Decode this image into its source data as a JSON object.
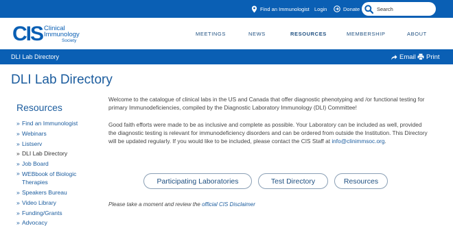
{
  "utility": {
    "find_immunologist": "Find an Immunologist",
    "login": "Login",
    "donate": "Donate",
    "search_placeholder": "Search"
  },
  "logo": {
    "mark": "CIS",
    "line1": "Clinical",
    "line2": "Immunology",
    "line3": "Society"
  },
  "nav": {
    "meetings": "MEETINGS",
    "news": "NEWS",
    "resources": "RESOURCES",
    "membership": "MEMBERSHIP",
    "about": "ABOUT"
  },
  "breadcrumb": {
    "current": "DLI Lab Directory",
    "email": "Email",
    "print": "Print"
  },
  "page": {
    "title": "DLI Lab Directory"
  },
  "sidebar": {
    "title": "Resources",
    "items": [
      "Find an Immunologist",
      "Webinars",
      "Listserv",
      "DLI Lab Directory",
      "Job Board",
      "WEBbook of Biologic Therapies",
      "Speakers Bureau",
      "Video Library",
      "Funding/Grants",
      "Advocacy"
    ]
  },
  "main": {
    "intro": "Welcome to the catalogue of clinical labs in the US and Canada that offer diagnostic phenotyping and /or functional testing for primary Immunodeficiencies, compiled by the Diagnostic Laboratory Immunology (DLI) Committee!",
    "body": "Good faith efforts were made to be as inclusive and complete as possible. Your Laboratory can be included as well, provided the diagnostic testing is relevant for immunodeficiency disorders and can be ordered from outside the Institution. This Directory will be updated regularly. If you would like to be included, please contact the CIS Staff at ",
    "email_link": "info@clinimmsoc.org",
    "body_end": ".",
    "buttons": {
      "labs": "Participating Laboratories",
      "directory": "Test Directory",
      "resources": "Resources"
    },
    "disclaimer_prefix": "Please take a moment and review the ",
    "disclaimer_link": "official CIS Disclaimer"
  },
  "colors": {
    "brand_blue": "#0a5fb4",
    "link_blue": "#1b5c9e"
  }
}
